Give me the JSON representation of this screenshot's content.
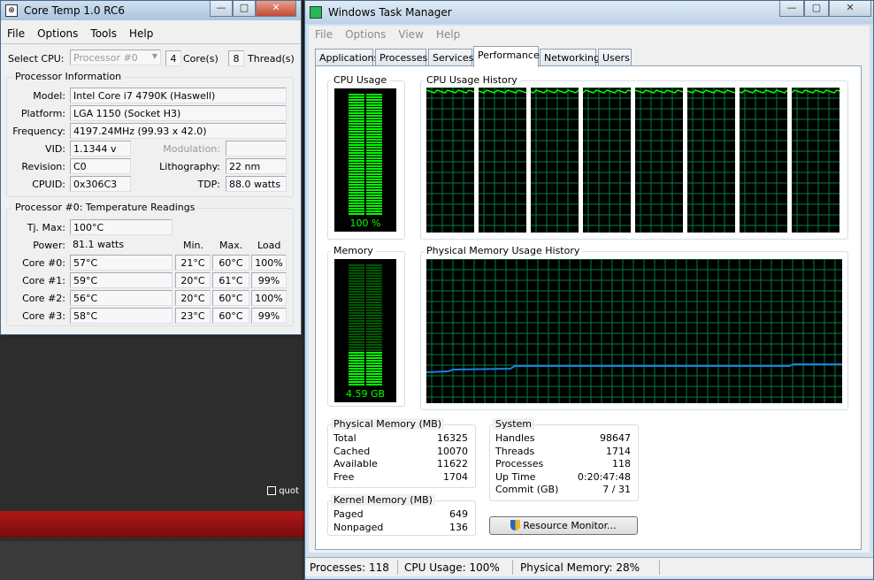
{
  "coretemp": {
    "title": "Core Temp 1.0 RC6",
    "menu": [
      "File",
      "Options",
      "Tools",
      "Help"
    ],
    "select_cpu_label": "Select CPU:",
    "select_cpu_value": "Processor #0",
    "cores_value": "4",
    "cores_label": "Core(s)",
    "threads_value": "8",
    "threads_label": "Thread(s)",
    "proc_info_title": "Processor Information",
    "model_label": "Model:",
    "model_value": "Intel Core i7 4790K (Haswell)",
    "platform_label": "Platform:",
    "platform_value": "LGA 1150 (Socket H3)",
    "frequency_label": "Frequency:",
    "frequency_value": "4197.24MHz (99.93 x 42.0)",
    "vid_label": "VID:",
    "vid_value": "1.1344 v",
    "modulation_label": "Modulation:",
    "modulation_value": "",
    "revision_label": "Revision:",
    "revision_value": "C0",
    "lithography_label": "Lithography:",
    "lithography_value": "22 nm",
    "cpuid_label": "CPUID:",
    "cpuid_value": "0x306C3",
    "tdp_label": "TDP:",
    "tdp_value": "88.0 watts",
    "temps_title": "Processor #0: Temperature Readings",
    "tjmax_label": "Tj. Max:",
    "tjmax_value": "100°C",
    "power_label": "Power:",
    "power_value": "81.1 watts",
    "col_min": "Min.",
    "col_max": "Max.",
    "col_load": "Load",
    "cores": [
      {
        "label": "Core #0:",
        "temp": "57°C",
        "min": "21°C",
        "max": "60°C",
        "load": "100%"
      },
      {
        "label": "Core #1:",
        "temp": "59°C",
        "min": "20°C",
        "max": "61°C",
        "load": "99%"
      },
      {
        "label": "Core #2:",
        "temp": "56°C",
        "min": "20°C",
        "max": "60°C",
        "load": "100%"
      },
      {
        "label": "Core #3:",
        "temp": "58°C",
        "min": "23°C",
        "max": "60°C",
        "load": "99%"
      }
    ]
  },
  "background": {
    "quot_label": "quot"
  },
  "taskmgr": {
    "title": "Windows Task Manager",
    "menu": [
      "File",
      "Options",
      "View",
      "Help"
    ],
    "tabs": [
      "Applications",
      "Processes",
      "Services",
      "Performance",
      "Networking",
      "Users"
    ],
    "active_tab": "Performance",
    "cpu_usage_title": "CPU Usage",
    "cpu_usage_value": "100 %",
    "cpu_usage_fraction": 1.0,
    "cpu_history_title": "CPU Usage History",
    "memory_title": "Memory",
    "memory_value": "4.59 GB",
    "memory_fraction": 0.28,
    "mem_history_title": "Physical Memory Usage History",
    "physical_memory": {
      "title": "Physical Memory (MB)",
      "rows": [
        {
          "label": "Total",
          "value": "16325"
        },
        {
          "label": "Cached",
          "value": "10070"
        },
        {
          "label": "Available",
          "value": "11622"
        },
        {
          "label": "Free",
          "value": "1704"
        }
      ]
    },
    "kernel_memory": {
      "title": "Kernel Memory (MB)",
      "rows": [
        {
          "label": "Paged",
          "value": "649"
        },
        {
          "label": "Nonpaged",
          "value": "136"
        }
      ]
    },
    "system": {
      "title": "System",
      "rows": [
        {
          "label": "Handles",
          "value": "98647"
        },
        {
          "label": "Threads",
          "value": "1714"
        },
        {
          "label": "Processes",
          "value": "118"
        },
        {
          "label": "Up Time",
          "value": "0:20:47:48"
        },
        {
          "label": "Commit (GB)",
          "value": "7 / 31"
        }
      ]
    },
    "resource_monitor_label": "Resource Monitor...",
    "status": {
      "processes": "Processes: 118",
      "cpu": "CPU Usage: 100%",
      "memory": "Physical Memory: 28%"
    },
    "colors": {
      "graph_green": "#00ff00",
      "grid_green": "#008040",
      "mem_line": "#1e7fe0"
    }
  }
}
